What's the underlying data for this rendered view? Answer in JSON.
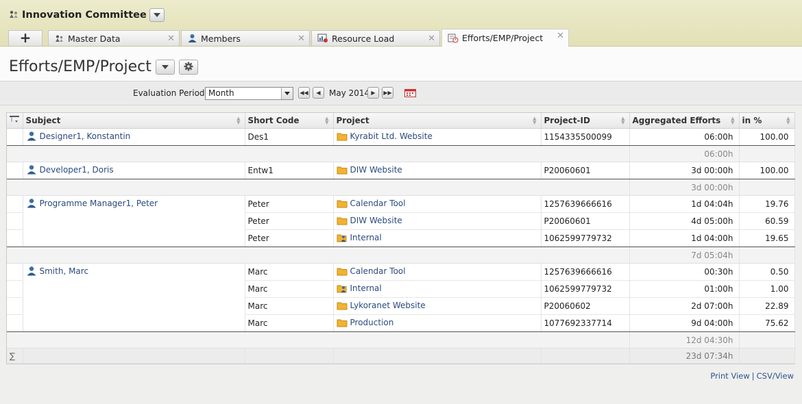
{
  "app": {
    "title": "Innovation Committee"
  },
  "tabs": [
    {
      "label": "Master Data",
      "icon": "master-data-icon"
    },
    {
      "label": "Members",
      "icon": "members-icon"
    },
    {
      "label": "Resource Load",
      "icon": "resource-load-icon"
    },
    {
      "label": "Efforts/EMP/Project",
      "icon": "efforts-icon",
      "active": true
    }
  ],
  "page": {
    "title": "Efforts/EMP/Project"
  },
  "filter": {
    "label": "Evaluation Period",
    "period_value": "Month",
    "period_text": "May 2014"
  },
  "table": {
    "headers": {
      "subject": "Subject",
      "short_code": "Short Code",
      "project": "Project",
      "project_id": "Project-ID",
      "aggregated": "Aggregated Efforts",
      "percent": "in %"
    },
    "groups": [
      {
        "subject": "Designer1, Konstantin",
        "rows": [
          {
            "short_code": "Des1",
            "project": "Kyrabit Ltd. Website",
            "project_icon": "folder-icon",
            "project_id": "1154335500099",
            "efforts": "06:00h",
            "percent": "100.00"
          }
        ],
        "subtotal": "06:00h"
      },
      {
        "subject": "Developer1, Doris",
        "rows": [
          {
            "short_code": "Entw1",
            "project": "DIW Website",
            "project_icon": "folder-icon",
            "project_id": "P20060601",
            "efforts": "3d 00:00h",
            "percent": "100.00"
          }
        ],
        "subtotal": "3d 00:00h"
      },
      {
        "subject": "Programme Manager1, Peter",
        "rows": [
          {
            "short_code": "Peter",
            "project": "Calendar Tool",
            "project_icon": "folder-icon",
            "project_id": "1257639666616",
            "efforts": "1d 04:04h",
            "percent": "19.76"
          },
          {
            "short_code": "Peter",
            "project": "DIW Website",
            "project_icon": "folder-icon",
            "project_id": "P20060601",
            "efforts": "4d 05:00h",
            "percent": "60.59"
          },
          {
            "short_code": "Peter",
            "project": "Internal",
            "project_icon": "internal-project-icon",
            "project_id": "1062599779732",
            "efforts": "1d 04:00h",
            "percent": "19.65"
          }
        ],
        "subtotal": "7d 05:04h"
      },
      {
        "subject": "Smith, Marc",
        "rows": [
          {
            "short_code": "Marc",
            "project": "Calendar Tool",
            "project_icon": "folder-icon",
            "project_id": "1257639666616",
            "efforts": "00:30h",
            "percent": "0.50"
          },
          {
            "short_code": "Marc",
            "project": "Internal",
            "project_icon": "internal-project-icon",
            "project_id": "1062599779732",
            "efforts": "01:00h",
            "percent": "1.00"
          },
          {
            "short_code": "Marc",
            "project": "Lykoranet Website",
            "project_icon": "folder-icon",
            "project_id": "P20060602",
            "efforts": "2d 07:00h",
            "percent": "22.89"
          },
          {
            "short_code": "Marc",
            "project": "Production",
            "project_icon": "folder-icon",
            "project_id": "1077692337714",
            "efforts": "9d 04:00h",
            "percent": "75.62"
          }
        ],
        "subtotal": "12d 04:30h"
      }
    ],
    "total_symbol": "∑",
    "total": "23d 07:34h"
  },
  "footer": {
    "print_view": "Print View",
    "separator": "|",
    "csv_view": "CSV/View"
  }
}
